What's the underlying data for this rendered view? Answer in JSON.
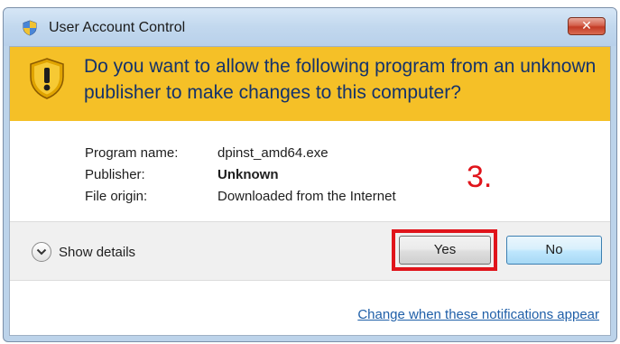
{
  "window": {
    "title": "User Account Control",
    "title_icon": "uac-shield-icon",
    "close_glyph": "✕"
  },
  "banner": {
    "icon": "warning-shield-icon",
    "message": "Do you want to allow the following program from an unknown publisher to make changes to this computer?",
    "background": "#f5c027",
    "text_color": "#14326b"
  },
  "info": {
    "rows": [
      {
        "label": "Program name:",
        "value": "dpinst_amd64.exe"
      },
      {
        "label": "Publisher:",
        "value": "Unknown"
      },
      {
        "label": "File origin:",
        "value": "Downloaded from the Internet"
      }
    ]
  },
  "actions": {
    "details_label": "Show details",
    "details_icon": "chevron-down-icon",
    "yes_label": "Yes",
    "no_label": "No"
  },
  "annotation": {
    "step_text": "3.",
    "color": "#e0141b"
  },
  "footer": {
    "link_text": "Change when these notifications appear",
    "link_color": "#1f5fa8"
  }
}
